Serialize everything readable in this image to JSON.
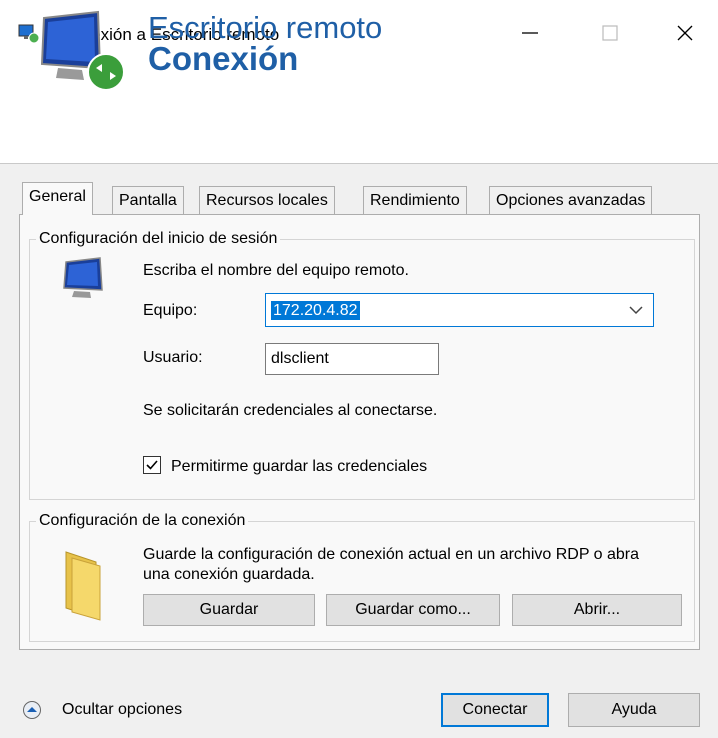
{
  "window": {
    "title": "Conexión a Escritorio remoto",
    "icons": {
      "app": "remote-desktop-icon",
      "minimize": "minimize-icon",
      "maximize": "maximize-icon",
      "close": "close-icon"
    }
  },
  "banner": {
    "title_line1": "Escritorio remoto",
    "title_line2": "Conexión",
    "icon": "monitor-connect-icon"
  },
  "tabs": [
    {
      "label": "General",
      "selected": true
    },
    {
      "label": "Pantalla"
    },
    {
      "label": "Recursos locales"
    },
    {
      "label": "Rendimiento"
    },
    {
      "label": "Opciones avanzadas"
    }
  ],
  "login_group": {
    "legend": "Configuración del inicio de sesión",
    "instruction": "Escriba el nombre del equipo remoto.",
    "computer_label": "Equipo:",
    "computer_value": "172.20.4.82",
    "user_label": "Usuario:",
    "user_value": "dlsclient",
    "credentials_note": "Se solicitarán credenciales al conectarse.",
    "save_credentials_label": "Permitirme guardar las credenciales",
    "save_credentials_checked": true
  },
  "connection_group": {
    "legend": "Configuración de la conexión",
    "description": "Guarde la configuración de conexión actual en un archivo RDP o abra una conexión guardada.",
    "save_button": "Guardar",
    "save_as_button": "Guardar como...",
    "open_button": "Abrir..."
  },
  "footer": {
    "toggle_label": "Ocultar opciones",
    "connect_button": "Conectar",
    "help_button": "Ayuda"
  },
  "colors": {
    "accent": "#0078d7",
    "banner_text": "#1f5fa6"
  }
}
